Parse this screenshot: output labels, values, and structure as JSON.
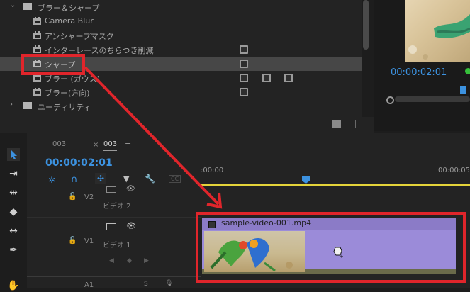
{
  "effects": {
    "folder_blur": "ブラー＆シャープ",
    "items": [
      {
        "label": "Camera Blur"
      },
      {
        "label": "アンシャープマスク"
      },
      {
        "label": "インターレースのちらつき削減"
      },
      {
        "label": "シャープ"
      },
      {
        "label": "ブラー (ガウス)"
      },
      {
        "label": "ブラー(方向)"
      }
    ],
    "folder_utility": "ユーティリティ"
  },
  "program_monitor": {
    "timecode": "00:00:02:01"
  },
  "timeline": {
    "tab_inactive": "003",
    "tab_close": "×",
    "tab_active": "003",
    "timecode": "00:00:02:01",
    "ruler_start": ":00:00",
    "ruler_end": "00:00:05",
    "tracks": [
      {
        "id": "V2",
        "name": "ビデオ 2"
      },
      {
        "id": "V1",
        "name": "ビデオ 1"
      },
      {
        "id": "A1",
        "name": ""
      }
    ],
    "clip_name": "sample-video-001.mp4",
    "cc_label": "CC"
  },
  "colors": {
    "accent": "#3c92e0",
    "highlight": "#e0252b",
    "clip": "#9b8bd9",
    "work_area": "#e4d33a"
  }
}
